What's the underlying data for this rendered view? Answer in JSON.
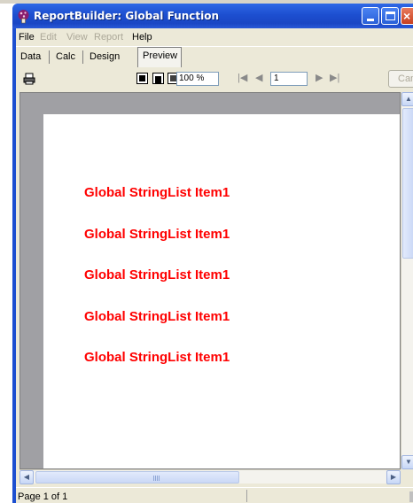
{
  "window": {
    "title": "ReportBuilder: Global Function",
    "icon": "mushroom-app-icon",
    "controls": {
      "minimize": "minimize-icon",
      "maximize": "maximize-icon",
      "close": "close-icon"
    },
    "title_bar_color": "#1d4fd0"
  },
  "menu": {
    "items": [
      {
        "label": "File",
        "enabled": true
      },
      {
        "label": "Edit",
        "enabled": false
      },
      {
        "label": "View",
        "enabled": false
      },
      {
        "label": "Report",
        "enabled": false
      },
      {
        "label": "Help",
        "enabled": true
      }
    ]
  },
  "tabs": {
    "items": [
      {
        "label": "Data"
      },
      {
        "label": "Calc"
      },
      {
        "label": "Design"
      },
      {
        "label": "Preview"
      }
    ],
    "active": "Preview"
  },
  "toolbar": {
    "print_icon": "printer-icon",
    "view_buttons": [
      "whole-page-icon",
      "page-width-icon",
      "hundred-percent-icon"
    ],
    "zoom": "100 %",
    "nav_icons": [
      "first-page-icon",
      "prior-page-icon",
      "next-page-icon",
      "last-page-icon"
    ],
    "page_number": "1",
    "cancel_label": "Can"
  },
  "report": {
    "text_color": "#ff0000",
    "lines": [
      "Global StringList Item1",
      "Global StringList Item1",
      "Global StringList Item1",
      "Global StringList Item1",
      "Global StringList Item1"
    ]
  },
  "status": {
    "text": "Page 1 of 1"
  }
}
